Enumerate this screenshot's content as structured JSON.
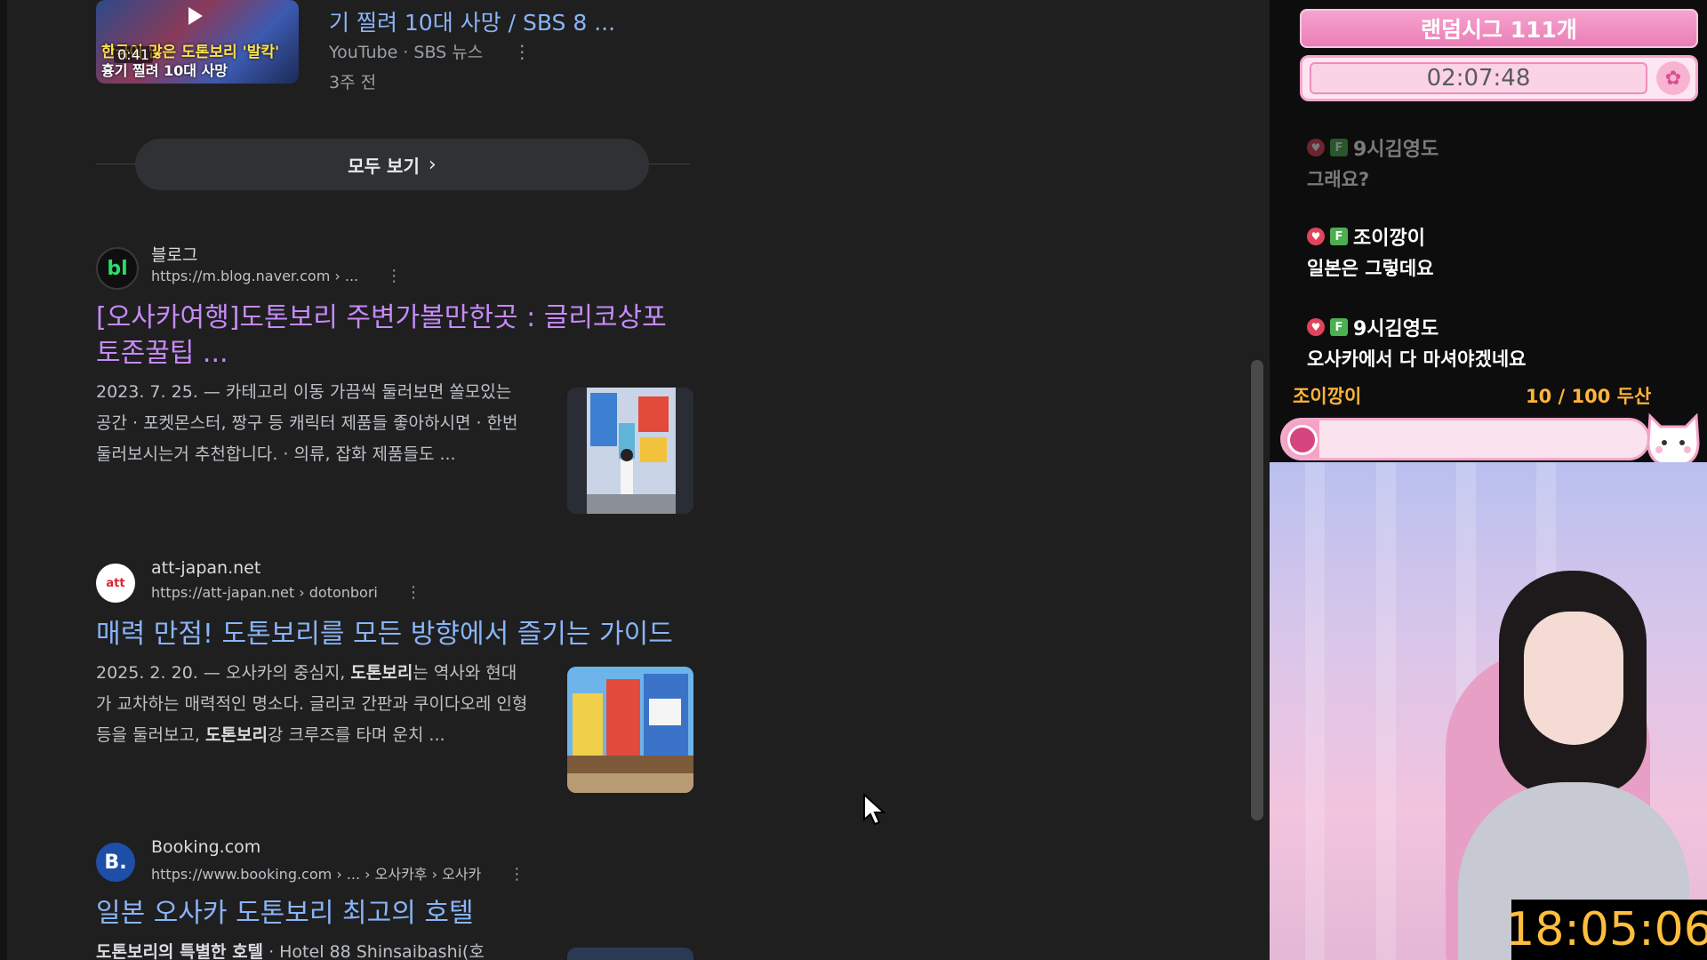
{
  "video": {
    "title": "기 찔려 10대 사망 / SBS 8 ...",
    "meta": "YouTube · SBS 뉴스",
    "age": "3주 전",
    "duration": "0:41",
    "thumb_caption_top": "한국이 많은 도톤보리 '발칵'",
    "thumb_caption_bottom": "흉기 찔려 10대 사망"
  },
  "see_all": {
    "label": "모두 보기"
  },
  "results": [
    {
      "site": "블로그",
      "url": "https://m.blog.naver.com › ...",
      "favicon_text": "bl",
      "title": "[오사카여행]도톤보리 주변가볼만한곳 : 글리코상포토존꿀팁 ...",
      "snippet": "2023. 7. 25. — 카테고리 이동 가끔씩 둘러보면 쏠모있는 공간 · 포켓몬스터, 짱구 등 캐릭터 제품들 좋아하시면 · 한번 둘러보시는거 추천합니다. · 의류, 잡화 제품들도 ..."
    },
    {
      "site": "att-japan.net",
      "url": "https://att-japan.net › dotonbori",
      "favicon_text": "att",
      "title": "매력 만점! 도톤보리를 모든 방향에서 즐기는 가이드",
      "snippet_parts": [
        "2025. 2. 20. — 오사카의 중심지, ",
        "도톤보리",
        "는 역사와 현대가 교차하는 매력적인 명소다. 글리코 간판과 쿠이다오레 인형 등을 둘러보고, ",
        "도톤보리",
        "강 크루즈를 타며 운치 ..."
      ]
    },
    {
      "site": "Booking.com",
      "url": "https://www.booking.com › ... › 오사카후 › 오사카",
      "favicon_text": "B.",
      "title": "일본 오사카 도톤보리 최고의 호텔",
      "snippet_parts": [
        "도톤보리의 특별한 호텔",
        " · Hotel 88 Shinsaibashi(호"
      ]
    }
  ],
  "stream": {
    "banner": "랜덤시그 111개",
    "timer": "02:07:48",
    "chat": [
      {
        "user": "9시김영도",
        "message": "그래요?"
      },
      {
        "user": "조이깡이",
        "message": "일본은 그렇데요"
      },
      {
        "user": "9시김영도",
        "message": "오사카에서 다 마셔야겠네요"
      }
    ],
    "badge_letter": "F",
    "goal_user": "조이깡이",
    "goal_count": "10 / 100 두산",
    "goal_progress": 0.1,
    "clock": "18:05:06"
  },
  "icons": {
    "kebab": "more-vert-icon",
    "chevron": "chevron-right-icon",
    "cursor": "mouse-pointer-icon",
    "paw": "paw-icon"
  },
  "colors": {
    "link": "#8ab4f8",
    "visited": "#c58af9",
    "accent_pink": "#f5a2c8",
    "goal_text": "#ffb43a"
  }
}
